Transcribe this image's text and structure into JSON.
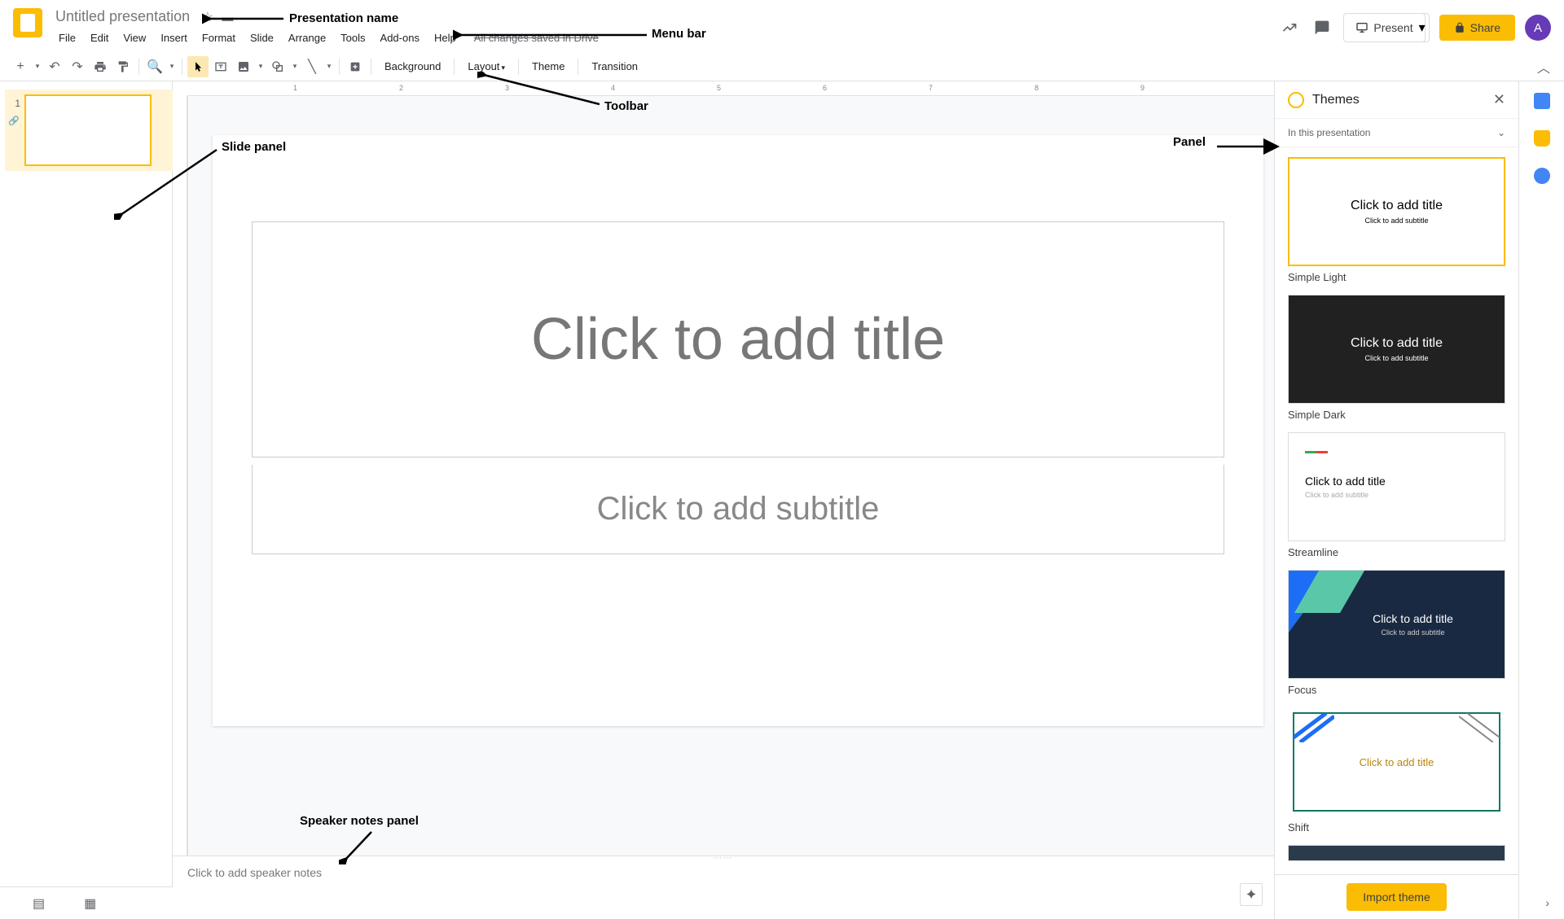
{
  "header": {
    "doc_title": "Untitled presentation",
    "save_status": "All changes saved in Drive",
    "menu": [
      "File",
      "Edit",
      "View",
      "Insert",
      "Format",
      "Slide",
      "Arrange",
      "Tools",
      "Add-ons",
      "Help"
    ],
    "present_label": "Present",
    "share_label": "Share",
    "avatar_initial": "A"
  },
  "toolbar": {
    "background_label": "Background",
    "layout_label": "Layout",
    "theme_label": "Theme",
    "transition_label": "Transition"
  },
  "slide_panel": {
    "slides": [
      {
        "number": "1"
      }
    ]
  },
  "ruler": {
    "ticks": [
      "1",
      "2",
      "3",
      "4",
      "5",
      "6",
      "7",
      "8",
      "9"
    ]
  },
  "canvas": {
    "title_placeholder": "Click to add title",
    "subtitle_placeholder": "Click to add subtitle"
  },
  "speaker_notes": {
    "placeholder": "Click to add speaker notes"
  },
  "themes": {
    "panel_title": "Themes",
    "scope_label": "In this presentation",
    "import_label": "Import theme",
    "items": [
      {
        "name": "Simple Light",
        "title": "Click to add title",
        "sub": "Click to add subtitle",
        "variant": "light",
        "selected": true
      },
      {
        "name": "Simple Dark",
        "title": "Click to add title",
        "sub": "Click to add subtitle",
        "variant": "dark"
      },
      {
        "name": "Streamline",
        "title": "Click to add title",
        "sub": "Click to add subtitle",
        "variant": "streamline"
      },
      {
        "name": "Focus",
        "title": "Click to add title",
        "sub": "Click to add subtitle",
        "variant": "focus"
      },
      {
        "name": "Shift",
        "title": "Click to add title",
        "sub": "",
        "variant": "shift"
      }
    ]
  },
  "annotations": {
    "presentation_name": "Presentation name",
    "menu_bar": "Menu bar",
    "toolbar": "Toolbar",
    "slide_panel": "Slide panel",
    "panel": "Panel",
    "speaker_notes": "Speaker notes panel"
  }
}
